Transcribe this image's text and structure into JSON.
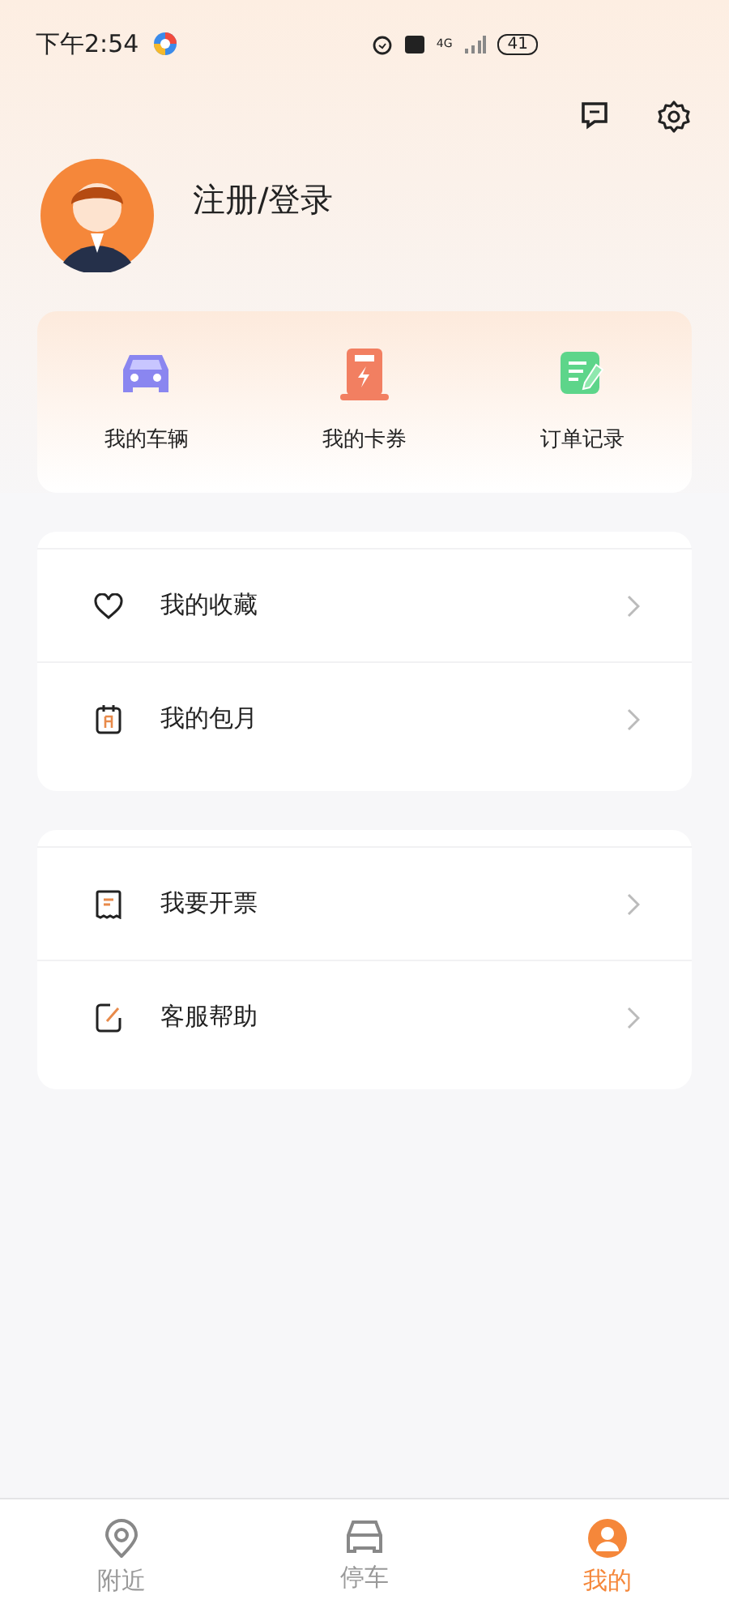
{
  "status_bar": {
    "time": "下午2:54",
    "network": "4G",
    "battery": "41"
  },
  "profile": {
    "login": "注册/登录"
  },
  "shortcuts": [
    {
      "kind": "car",
      "label": "我的车辆"
    },
    {
      "kind": "charger",
      "label": "我的卡券"
    },
    {
      "kind": "note",
      "label": "订单记录"
    }
  ],
  "menu_groups": [
    [
      {
        "kind": "heart",
        "label": "我的收藏"
      },
      {
        "kind": "calendar",
        "label": "我的包月"
      }
    ],
    [
      {
        "kind": "receipt",
        "label": "我要开票"
      },
      {
        "kind": "edit",
        "label": "客服帮助"
      }
    ]
  ],
  "tab_bar": [
    {
      "kind": "nearby",
      "label": "附近",
      "selected": false
    },
    {
      "kind": "park",
      "label": "停车",
      "selected": false
    },
    {
      "kind": "me",
      "label": "我的",
      "selected": true
    }
  ]
}
